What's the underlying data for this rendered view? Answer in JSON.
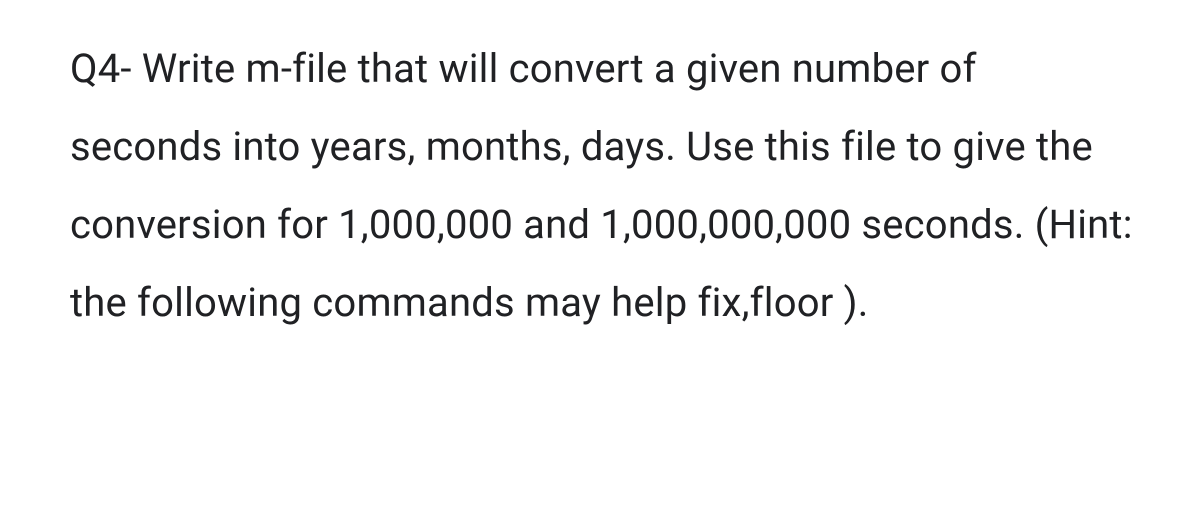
{
  "question": {
    "text": "Q4- Write m-file that will convert a given number of seconds into years, months, days. Use this file to give the conversion for 1,000,000 and 1,000,000,000 seconds. (Hint: the following commands may help fix,floor )."
  }
}
